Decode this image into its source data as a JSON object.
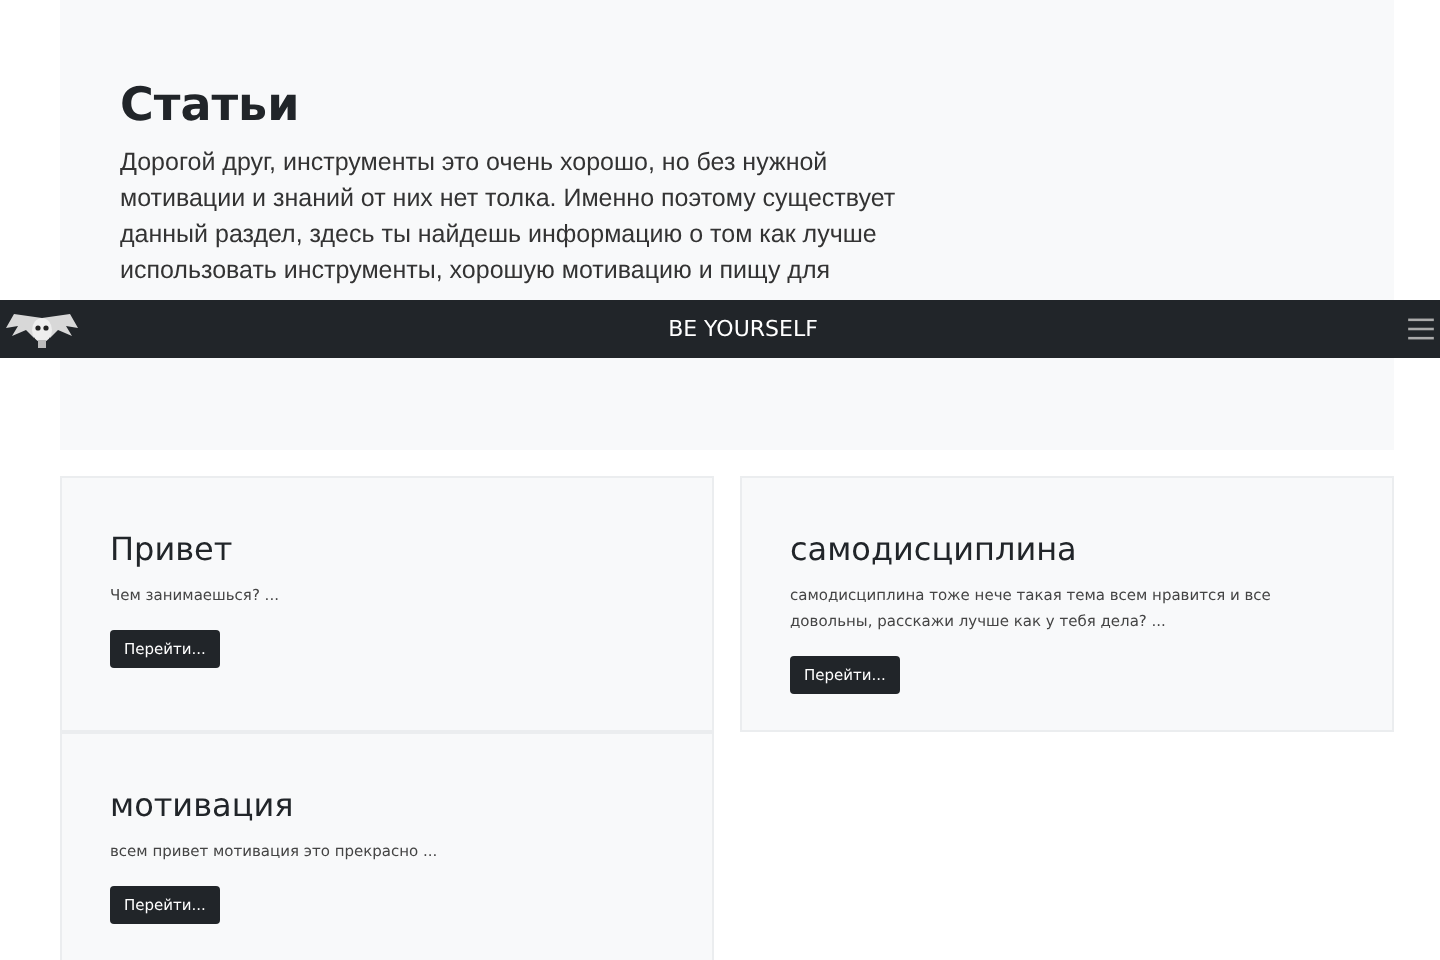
{
  "hero": {
    "title": "Статьи",
    "text": "Дорогой друг, инструменты это очень хорошо, но без нужной мотивации и знаний от них нет толка. Именно поэтому существует данный раздел, здесь ты найдешь информацию о том как лучше использовать инструменты, хорошую мотивацию и пищу для"
  },
  "navbar": {
    "brand": "BE YOURSELF"
  },
  "columns": [
    {
      "cards": [
        {
          "title": "Привет",
          "text": "Чем занимаешься? ...",
          "button": "Перейти..."
        },
        {
          "title": "мотивация",
          "text": "всем привет мотивация это прекрасно ...",
          "button": "Перейти..."
        }
      ]
    },
    {
      "cards": [
        {
          "title": "самодисциплина",
          "text": "самодисциплина тоже нече такая тема всем нравится и все довольны, расскажи лучше как у тебя дела? ...",
          "button": "Перейти..."
        }
      ]
    }
  ]
}
